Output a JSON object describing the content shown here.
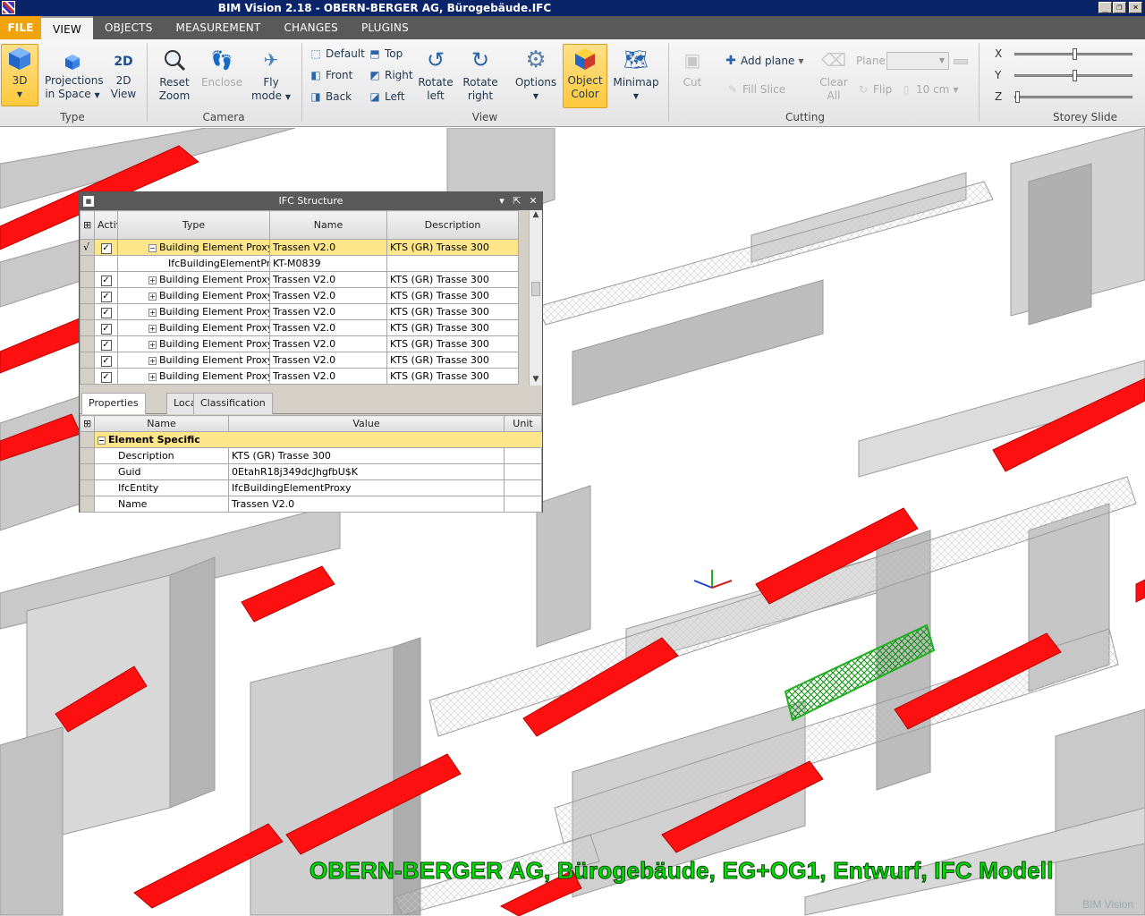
{
  "window": {
    "title": "BIM Vision 2.18 - OBERN-BERGER AG, Bürogebäude.IFC"
  },
  "tabs": [
    "FILE",
    "VIEW",
    "OBJECTS",
    "MEASUREMENT",
    "CHANGES",
    "PLUGINS"
  ],
  "ribbon": {
    "type": {
      "btn_3d": "3D",
      "projections1": "Projections",
      "projections2": "in Space",
      "view2d_1": "2D",
      "view2d_2": "View",
      "label": "Type"
    },
    "camera": {
      "reset1": "Reset",
      "reset2": "Zoom",
      "enclose": "Enclose",
      "fly1": "Fly",
      "fly2": "mode",
      "label": "Camera"
    },
    "view": {
      "default": "Default",
      "front": "Front",
      "back": "Back",
      "top": "Top",
      "right": "Right",
      "left": "Left",
      "rotl1": "Rotate",
      "rotl2": "left",
      "rotr1": "Rotate",
      "rotr2": "right",
      "options": "Options",
      "objcolor1": "Object",
      "objcolor2": "Color",
      "minimap": "Minimap",
      "label": "View"
    },
    "cutting": {
      "cut": "Cut",
      "addplane": "Add plane",
      "fillslice": "Fill Slice",
      "clear1": "Clear",
      "clear2": "All",
      "flip": "Flip",
      "plane": "Plane",
      "thickness": "10 cm",
      "label": "Cutting"
    },
    "storey": {
      "x": "X",
      "y": "Y",
      "z": "Z",
      "label": "Storey Slide",
      "x_level": 0.52,
      "y_level": 0.52,
      "z_level": 0.0
    }
  },
  "ifc_panel": {
    "title": "IFC Structure",
    "columns": [
      "Active",
      "Type",
      "Name",
      "Description"
    ],
    "rows": [
      {
        "type": "Building Element Proxy",
        "name": "Trassen V2.0",
        "desc": "KTS (GR) Trasse 300"
      },
      {
        "type": "IfcBuildingElementPr...",
        "name": "KT-M0839",
        "desc": ""
      },
      {
        "type": "Building Element Proxy",
        "name": "Trassen V2.0",
        "desc": "KTS (GR) Trasse 300"
      },
      {
        "type": "Building Element Proxy",
        "name": "Trassen V2.0",
        "desc": "KTS (GR) Trasse 300"
      },
      {
        "type": "Building Element Proxy",
        "name": "Trassen V2.0",
        "desc": "KTS (GR) Trasse 300"
      },
      {
        "type": "Building Element Proxy",
        "name": "Trassen V2.0",
        "desc": "KTS (GR) Trasse 300"
      },
      {
        "type": "Building Element Proxy",
        "name": "Trassen V2.0",
        "desc": "KTS (GR) Trasse 300"
      },
      {
        "type": "Building Element Proxy",
        "name": "Trassen V2.0",
        "desc": "KTS (GR) Trasse 300"
      },
      {
        "type": "Building Element Proxy",
        "name": "Trassen V2.0",
        "desc": "KTS (GR) Trasse 300"
      }
    ],
    "prop_tabs": [
      "Properties",
      "Location",
      "Classification"
    ],
    "prop_columns": [
      "Name",
      "Value",
      "Unit"
    ],
    "group": "Element Specific",
    "props": [
      {
        "name": "Description",
        "value": "KTS (GR) Trasse 300"
      },
      {
        "name": "Guid",
        "value": "0EtahR18j349dcJhgfbU$K"
      },
      {
        "name": "IfcEntity",
        "value": "IfcBuildingElementProxy"
      },
      {
        "name": "Name",
        "value": "Trassen V2.0"
      }
    ]
  },
  "viewport": {
    "caption": "OBERN-BERGER AG, Bürogebäude, EG+OG1, Entwurf, IFC Modell",
    "logo": "BIM Vision"
  },
  "colors": {
    "accent": "#f0a30a",
    "highlight": "#fde68a",
    "red_elements": "#ff1010",
    "selected_tray": "#1fae1f"
  }
}
